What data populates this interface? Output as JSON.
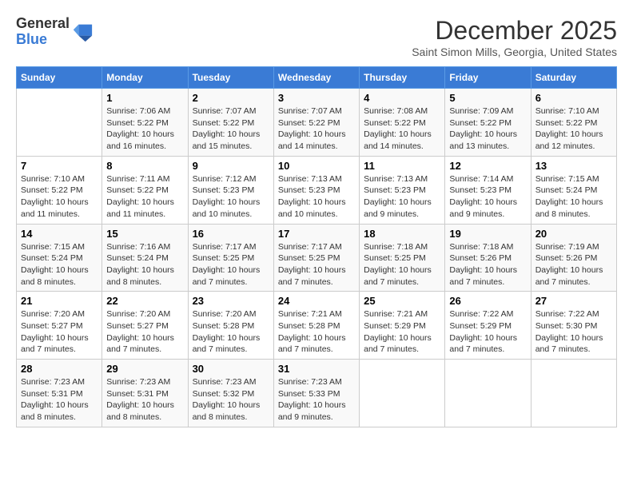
{
  "logo": {
    "general": "General",
    "blue": "Blue"
  },
  "title": "December 2025",
  "subtitle": "Saint Simon Mills, Georgia, United States",
  "headers": [
    "Sunday",
    "Monday",
    "Tuesday",
    "Wednesday",
    "Thursday",
    "Friday",
    "Saturday"
  ],
  "weeks": [
    [
      {
        "day": "",
        "info": ""
      },
      {
        "day": "1",
        "info": "Sunrise: 7:06 AM\nSunset: 5:22 PM\nDaylight: 10 hours and 16 minutes."
      },
      {
        "day": "2",
        "info": "Sunrise: 7:07 AM\nSunset: 5:22 PM\nDaylight: 10 hours and 15 minutes."
      },
      {
        "day": "3",
        "info": "Sunrise: 7:07 AM\nSunset: 5:22 PM\nDaylight: 10 hours and 14 minutes."
      },
      {
        "day": "4",
        "info": "Sunrise: 7:08 AM\nSunset: 5:22 PM\nDaylight: 10 hours and 14 minutes."
      },
      {
        "day": "5",
        "info": "Sunrise: 7:09 AM\nSunset: 5:22 PM\nDaylight: 10 hours and 13 minutes."
      },
      {
        "day": "6",
        "info": "Sunrise: 7:10 AM\nSunset: 5:22 PM\nDaylight: 10 hours and 12 minutes."
      }
    ],
    [
      {
        "day": "7",
        "info": "Sunrise: 7:10 AM\nSunset: 5:22 PM\nDaylight: 10 hours and 11 minutes."
      },
      {
        "day": "8",
        "info": "Sunrise: 7:11 AM\nSunset: 5:22 PM\nDaylight: 10 hours and 11 minutes."
      },
      {
        "day": "9",
        "info": "Sunrise: 7:12 AM\nSunset: 5:23 PM\nDaylight: 10 hours and 10 minutes."
      },
      {
        "day": "10",
        "info": "Sunrise: 7:13 AM\nSunset: 5:23 PM\nDaylight: 10 hours and 10 minutes."
      },
      {
        "day": "11",
        "info": "Sunrise: 7:13 AM\nSunset: 5:23 PM\nDaylight: 10 hours and 9 minutes."
      },
      {
        "day": "12",
        "info": "Sunrise: 7:14 AM\nSunset: 5:23 PM\nDaylight: 10 hours and 9 minutes."
      },
      {
        "day": "13",
        "info": "Sunrise: 7:15 AM\nSunset: 5:24 PM\nDaylight: 10 hours and 8 minutes."
      }
    ],
    [
      {
        "day": "14",
        "info": "Sunrise: 7:15 AM\nSunset: 5:24 PM\nDaylight: 10 hours and 8 minutes."
      },
      {
        "day": "15",
        "info": "Sunrise: 7:16 AM\nSunset: 5:24 PM\nDaylight: 10 hours and 8 minutes."
      },
      {
        "day": "16",
        "info": "Sunrise: 7:17 AM\nSunset: 5:25 PM\nDaylight: 10 hours and 7 minutes."
      },
      {
        "day": "17",
        "info": "Sunrise: 7:17 AM\nSunset: 5:25 PM\nDaylight: 10 hours and 7 minutes."
      },
      {
        "day": "18",
        "info": "Sunrise: 7:18 AM\nSunset: 5:25 PM\nDaylight: 10 hours and 7 minutes."
      },
      {
        "day": "19",
        "info": "Sunrise: 7:18 AM\nSunset: 5:26 PM\nDaylight: 10 hours and 7 minutes."
      },
      {
        "day": "20",
        "info": "Sunrise: 7:19 AM\nSunset: 5:26 PM\nDaylight: 10 hours and 7 minutes."
      }
    ],
    [
      {
        "day": "21",
        "info": "Sunrise: 7:20 AM\nSunset: 5:27 PM\nDaylight: 10 hours and 7 minutes."
      },
      {
        "day": "22",
        "info": "Sunrise: 7:20 AM\nSunset: 5:27 PM\nDaylight: 10 hours and 7 minutes."
      },
      {
        "day": "23",
        "info": "Sunrise: 7:20 AM\nSunset: 5:28 PM\nDaylight: 10 hours and 7 minutes."
      },
      {
        "day": "24",
        "info": "Sunrise: 7:21 AM\nSunset: 5:28 PM\nDaylight: 10 hours and 7 minutes."
      },
      {
        "day": "25",
        "info": "Sunrise: 7:21 AM\nSunset: 5:29 PM\nDaylight: 10 hours and 7 minutes."
      },
      {
        "day": "26",
        "info": "Sunrise: 7:22 AM\nSunset: 5:29 PM\nDaylight: 10 hours and 7 minutes."
      },
      {
        "day": "27",
        "info": "Sunrise: 7:22 AM\nSunset: 5:30 PM\nDaylight: 10 hours and 7 minutes."
      }
    ],
    [
      {
        "day": "28",
        "info": "Sunrise: 7:23 AM\nSunset: 5:31 PM\nDaylight: 10 hours and 8 minutes."
      },
      {
        "day": "29",
        "info": "Sunrise: 7:23 AM\nSunset: 5:31 PM\nDaylight: 10 hours and 8 minutes."
      },
      {
        "day": "30",
        "info": "Sunrise: 7:23 AM\nSunset: 5:32 PM\nDaylight: 10 hours and 8 minutes."
      },
      {
        "day": "31",
        "info": "Sunrise: 7:23 AM\nSunset: 5:33 PM\nDaylight: 10 hours and 9 minutes."
      },
      {
        "day": "",
        "info": ""
      },
      {
        "day": "",
        "info": ""
      },
      {
        "day": "",
        "info": ""
      }
    ]
  ]
}
